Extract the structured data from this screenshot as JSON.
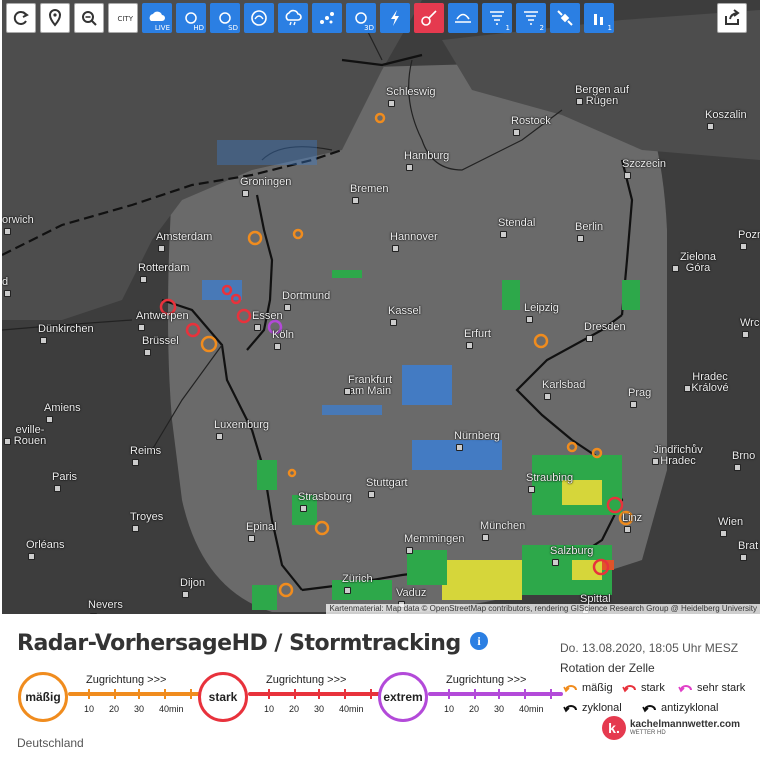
{
  "toolbar": {
    "buttons": [
      {
        "name": "refresh-button",
        "icon": "refresh-icon",
        "style": "white"
      },
      {
        "name": "location-button",
        "icon": "location-pin-icon",
        "style": "white"
      },
      {
        "name": "zoom-out-button",
        "icon": "zoom-out-icon",
        "style": "white"
      },
      {
        "name": "city-labels-button",
        "icon": "city-labels-icon",
        "style": "white"
      },
      {
        "name": "live-radar-button",
        "icon": "live-radar-icon",
        "style": "blue"
      },
      {
        "name": "radar-hd-button",
        "icon": "radar-hd-icon",
        "style": "blue"
      },
      {
        "name": "radar-sd-button",
        "icon": "radar-sd-icon",
        "style": "blue"
      },
      {
        "name": "forecast-button",
        "icon": "forecast-icon",
        "style": "blue"
      },
      {
        "name": "precipitation-type-button",
        "icon": "rain-cloud-icon",
        "style": "blue"
      },
      {
        "name": "hail-button",
        "icon": "hail-icon",
        "style": "blue"
      },
      {
        "name": "radar-3d-button",
        "icon": "radar-3d-icon",
        "style": "blue"
      },
      {
        "name": "lightning-button",
        "icon": "lightning-icon",
        "style": "blue"
      },
      {
        "name": "stormtracking-button",
        "icon": "stormtracking-icon",
        "style": "red"
      },
      {
        "name": "cloud-top-button",
        "icon": "cloud-top-icon",
        "style": "blue"
      },
      {
        "name": "tornado-1-button",
        "icon": "tornado-1-icon",
        "style": "blue"
      },
      {
        "name": "tornado-2-button",
        "icon": "tornado-2-icon",
        "style": "blue"
      },
      {
        "name": "satellite-button",
        "icon": "satellite-icon",
        "style": "blue"
      },
      {
        "name": "stations-button",
        "icon": "stations-icon",
        "style": "blue"
      }
    ],
    "labels": {
      "city": "CITY",
      "live": "LIVE",
      "hd": "HD",
      "sd": "SD",
      "d3": "3D",
      "t1": "1",
      "t2": "2",
      "st1": "1"
    },
    "share_icon": "share-icon"
  },
  "map": {
    "cities": [
      {
        "name": "Schleswig"
      },
      {
        "name": "Bergen auf Rügen"
      },
      {
        "name": "Rostock"
      },
      {
        "name": "Koszalin"
      },
      {
        "name": "Hamburg"
      },
      {
        "name": "Szczecin"
      },
      {
        "name": "Groningen"
      },
      {
        "name": "Bremen"
      },
      {
        "name": "orwich"
      },
      {
        "name": "Amsterdam"
      },
      {
        "name": "Hannover"
      },
      {
        "name": "Stendal"
      },
      {
        "name": "Berlin"
      },
      {
        "name": "Pozn"
      },
      {
        "name": "Zielona Góra"
      },
      {
        "name": "Rotterdam"
      },
      {
        "name": "Dortmund"
      },
      {
        "name": "Antwerpen"
      },
      {
        "name": "Essen"
      },
      {
        "name": "Kassel"
      },
      {
        "name": "Leipzig"
      },
      {
        "name": "Dünkirchen"
      },
      {
        "name": "Brüssel"
      },
      {
        "name": "Köln"
      },
      {
        "name": "Erfurt"
      },
      {
        "name": "Dresden"
      },
      {
        "name": "Wrc"
      },
      {
        "name": "Frankfurt am Main"
      },
      {
        "name": "Karlsbad"
      },
      {
        "name": "Hradec Králové"
      },
      {
        "name": "Prag"
      },
      {
        "name": "Amiens"
      },
      {
        "name": "eville-Rouen"
      },
      {
        "name": "Luxemburg"
      },
      {
        "name": "Nürnberg"
      },
      {
        "name": "Jindřichův Hradec"
      },
      {
        "name": "Brno"
      },
      {
        "name": "Reims"
      },
      {
        "name": "Paris"
      },
      {
        "name": "Stuttgart"
      },
      {
        "name": "Straubing"
      },
      {
        "name": "Strasbourg"
      },
      {
        "name": "Linz"
      },
      {
        "name": "Wien"
      },
      {
        "name": "Troyes"
      },
      {
        "name": "Epinal"
      },
      {
        "name": "München"
      },
      {
        "name": "Brat"
      },
      {
        "name": "Orléans"
      },
      {
        "name": "Memmingen"
      },
      {
        "name": "Salzburg"
      },
      {
        "name": "Dijon"
      },
      {
        "name": "Zürich"
      },
      {
        "name": "Vaduz"
      },
      {
        "name": "Nevers"
      },
      {
        "name": "Spittal"
      },
      {
        "name": "d"
      }
    ],
    "attribution": "Kartenmaterial: Map data © OpenStreetMap contributors, rendering GIScience Research Group @ Heidelberg University"
  },
  "footer": {
    "title": "Radar-VorhersageHD / Stormtracking",
    "info_icon": "i",
    "datetime": "Do. 13.08.2020, 18:05 Uhr MESZ",
    "rotation_title": "Rotation der Zelle",
    "scales": [
      {
        "label": "mäßig",
        "color": "#f08c1e"
      },
      {
        "label": "stark",
        "color": "#e8323c"
      },
      {
        "label": "extrem",
        "color": "#b34ad9"
      }
    ],
    "scale_caption": "Zugrichtung >>>",
    "ticks": [
      "10",
      "20",
      "30",
      "40min"
    ],
    "legend": [
      {
        "label": "mäßig",
        "color": "#f08c1e"
      },
      {
        "label": "stark",
        "color": "#e8323c"
      },
      {
        "label": "sehr stark",
        "color": "#e040c8"
      },
      {
        "label": "zyklonal",
        "color": "#111111"
      },
      {
        "label": "antizyklonal",
        "color": "#111111"
      }
    ],
    "region": "Deutschland",
    "logo_name": "kachelmannwetter.com",
    "logo_sub": "WETTER HD",
    "logo_letter": "k."
  }
}
